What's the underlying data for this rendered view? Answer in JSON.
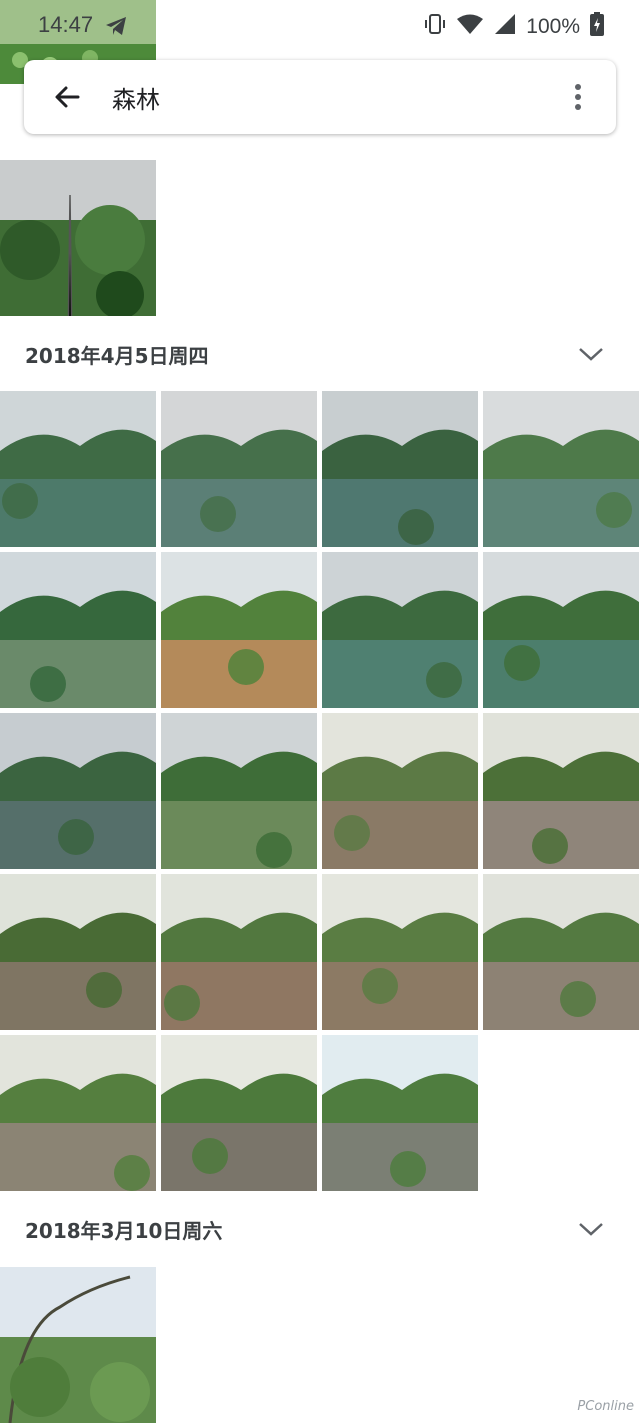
{
  "status_bar": {
    "time": "14:47",
    "battery": "100%",
    "icons": [
      "telegram-icon",
      "vibrate-icon",
      "wifi-icon",
      "signal-icon",
      "battery-charging-icon"
    ]
  },
  "search": {
    "query": "森林",
    "back_icon": "arrow-back-icon",
    "more_icon": "more-vert-icon"
  },
  "sections": [
    {
      "date": "2018年4月5日周四",
      "photo_count": 19
    },
    {
      "date": "2018年3月10日周六",
      "photo_count": 1
    }
  ],
  "watermark": "PConline"
}
